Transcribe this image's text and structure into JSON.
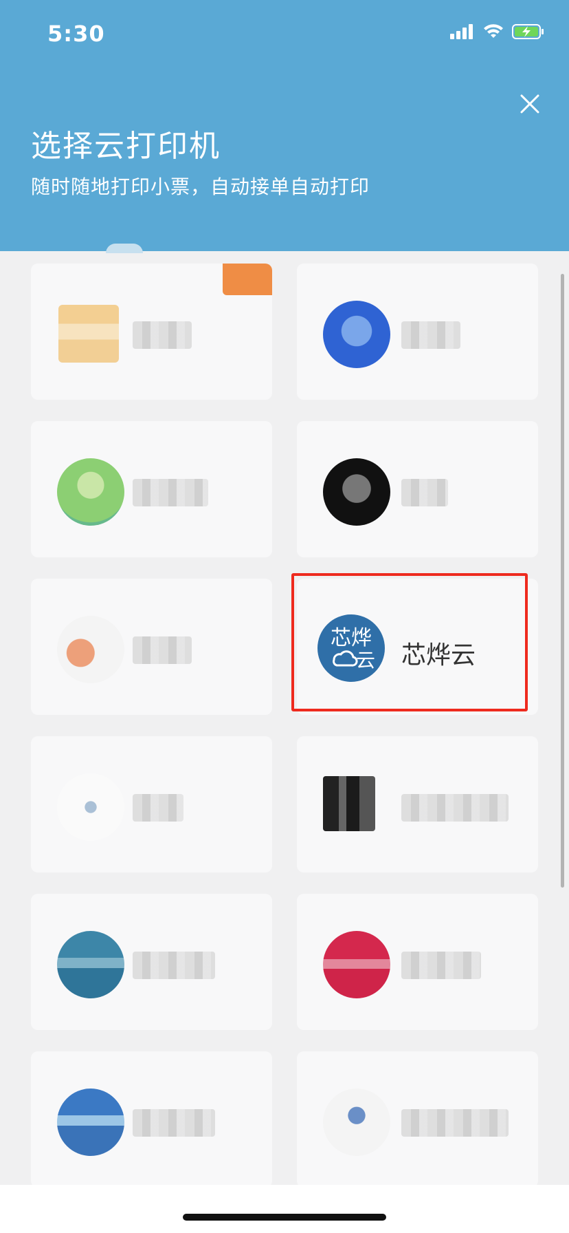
{
  "status": {
    "time": "5:30"
  },
  "header": {
    "title": "选择云打印机",
    "subtitle": "随时随地打印小票，自动接单自动打印"
  },
  "printers": [
    {
      "id": "p1",
      "name": "",
      "blurred": true
    },
    {
      "id": "p2",
      "name": "",
      "blurred": true
    },
    {
      "id": "p3",
      "name": "",
      "blurred": true
    },
    {
      "id": "p4",
      "name": "",
      "blurred": true
    },
    {
      "id": "p5",
      "name": "",
      "blurred": true
    },
    {
      "id": "p6",
      "name": "芯烨云",
      "logo_text_top": "芯烨",
      "logo_text_bottom": "云",
      "blurred": false,
      "selected": true
    },
    {
      "id": "p7",
      "name": "",
      "blurred": true
    },
    {
      "id": "p8",
      "name": "",
      "blurred": true
    },
    {
      "id": "p9",
      "name": "",
      "blurred": true
    },
    {
      "id": "p10",
      "name": "",
      "blurred": true
    },
    {
      "id": "p11",
      "name": "",
      "blurred": true
    },
    {
      "id": "p12",
      "name": "",
      "blurred": true
    }
  ],
  "colors": {
    "header_bg": "#5aa9d5",
    "highlight": "#ee2a1e",
    "xinye_logo": "#2f6fa8"
  }
}
